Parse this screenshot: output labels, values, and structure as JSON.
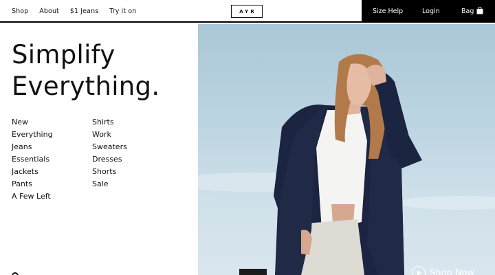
{
  "nav": {
    "left_links": [
      "Shop",
      "About",
      "$1 Jeans",
      "Try it on"
    ],
    "logo": "AYR",
    "right_links": {
      "size_help": "Size Help",
      "login": "Login",
      "bag": "Bag"
    }
  },
  "hero_text": {
    "line1": "Simplify",
    "line2": "Everything."
  },
  "menu": {
    "col_a": [
      "New",
      "Everything",
      "Jeans",
      "Essentials",
      "Jackets",
      "Pants",
      "A Few Left"
    ],
    "col_b": [
      "Shirts",
      "Work",
      "Sweaters",
      "Dresses",
      "Shorts",
      "Sale"
    ]
  },
  "hero": {
    "cta": "Shop Now"
  },
  "colors": {
    "topbar_dark": "#000000",
    "text": "#111111",
    "sky": "#bdd5e2",
    "coat": "#1b2440"
  },
  "icons": {
    "bag": "shopping-bag-icon",
    "play": "play-circle-icon"
  }
}
